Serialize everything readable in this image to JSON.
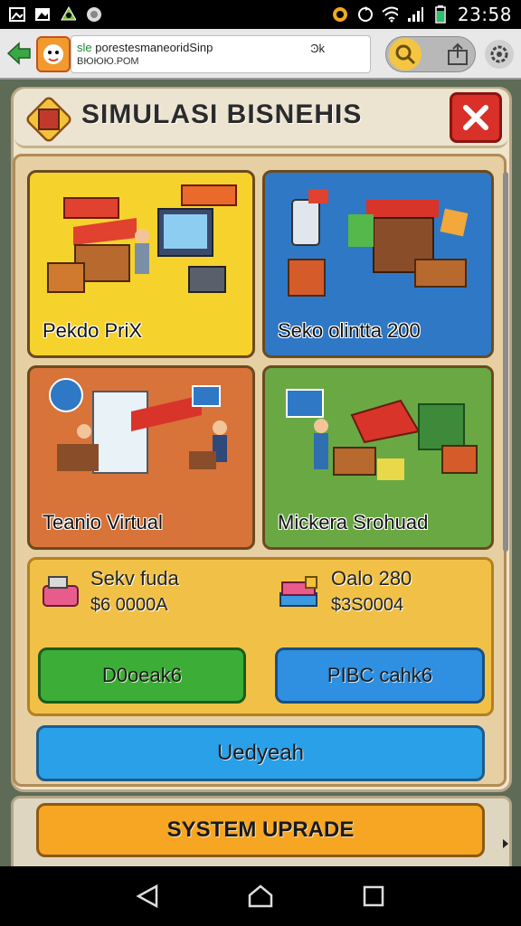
{
  "status_bar": {
    "time": "23:58",
    "left_icons": [
      "image-icon",
      "gallery-icon",
      "recycle-icon",
      "record-icon"
    ],
    "right_icons": [
      "alarm-icon",
      "sync-icon",
      "wifi-icon",
      "signal-icon",
      "battery-icon"
    ]
  },
  "browser": {
    "url_line1_prefix": "sle",
    "url_line1": " porestesmaneoridSinp",
    "url_line2": "ВЮЮЮ.РОМ",
    "url_right": "Ͽk"
  },
  "app": {
    "title": "SIMULASI BISNEHIS",
    "cards": [
      {
        "label": "Pekdo PriX",
        "color": "#f6d22c"
      },
      {
        "label": "Seko olintta 200",
        "color": "#2f78c6"
      },
      {
        "label": "Teanio Virtual",
        "color": "#d8733a"
      },
      {
        "label": "Mickera Srohuad",
        "color": "#6aa843"
      }
    ],
    "shop": {
      "items": [
        {
          "name": "Sekv fuda",
          "price": "$6 0000A"
        },
        {
          "name": "Oalo 280",
          "price": "$3S0004"
        }
      ],
      "green_button": "D0oeak6",
      "blue_button": "PIBC cahk6"
    },
    "wide_button": "Uedyeah",
    "upgrade_button": "SYSTEM UPRADE"
  },
  "colors": {
    "close_red": "#d9302a",
    "green": "#3cae38",
    "blue": "#2f8fe0",
    "orange": "#f6a623"
  }
}
